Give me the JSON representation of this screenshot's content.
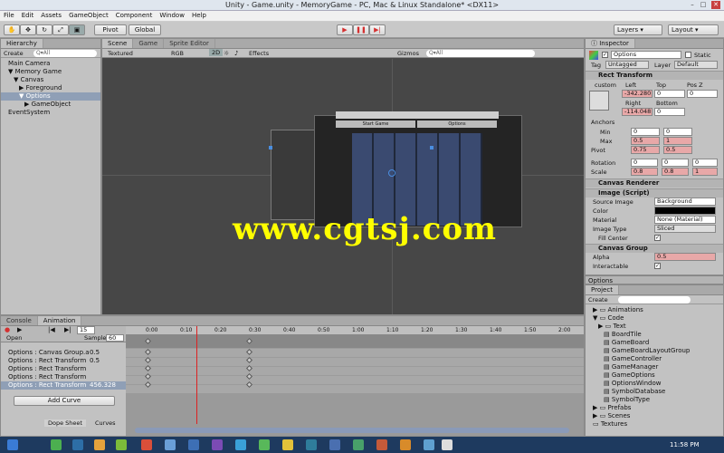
{
  "window": {
    "title": "Unity - Game.unity - MemoryGame - PC, Mac & Linux Standalone* <DX11>"
  },
  "menu": [
    "File",
    "Edit",
    "Assets",
    "GameObject",
    "Component",
    "Window",
    "Help"
  ],
  "toolbar": {
    "pivot": "Pivot",
    "global": "Global",
    "layers": "Layers",
    "layout": "Layout"
  },
  "hierarchy": {
    "tab": "Hierarchy",
    "create": "Create",
    "search_placeholder": "Q▾All",
    "items": [
      "Main Camera",
      "Memory Game",
      "Canvas",
      "Foreground",
      "Options",
      "GameObject",
      "EventSystem"
    ]
  },
  "scene": {
    "tabs": [
      "Scene",
      "Game",
      "Sprite Editor"
    ],
    "textured": "Textured",
    "rgb": "RGB",
    "mode2d": "2D",
    "effects": "Effects",
    "gizmos": "Gizmos",
    "search_placeholder": "Q▾All",
    "ui_buttons": [
      "Start Game",
      "Options"
    ],
    "watermark": "www.cgtsj.com"
  },
  "inspector": {
    "tab": "Inspector",
    "object_name": "Options",
    "static": "Static",
    "tag_label": "Tag",
    "tag": "Untagged",
    "layer_label": "Layer",
    "layer": "Default",
    "rect_transform": "Rect Transform",
    "anchor_preset": "custom",
    "stretch": "stretch",
    "left_label": "Left",
    "top_label": "Top",
    "posz_label": "Pos Z",
    "left": "-342.280",
    "top": "0",
    "posz": "0",
    "right_label": "Right",
    "bottom_label": "Bottom",
    "right": "-114.048",
    "bottom": "0",
    "anchors": "Anchors",
    "min": "Min",
    "max": "Max",
    "pivot": "Pivot",
    "min_x": "0",
    "min_y": "0",
    "max_x": "0.5",
    "max_y": "1",
    "pivot_x": "0.75",
    "pivot_y": "0.5",
    "rotation": "Rotation",
    "scale": "Scale",
    "rot_x": "0",
    "rot_y": "0",
    "rot_z": "0",
    "scale_x": "0.8",
    "scale_y": "0.8",
    "scale_z": "1",
    "canvas_renderer": "Canvas Renderer",
    "image": "Image (Script)",
    "source_image": "Source Image",
    "source_image_val": "Background",
    "color": "Color",
    "material": "Material",
    "material_val": "None (Material)",
    "image_type": "Image Type",
    "image_type_val": "Sliced",
    "fill_center": "Fill Center",
    "canvas_group": "Canvas Group",
    "alpha": "Alpha",
    "alpha_val": "0.5",
    "interactable": "Interactable",
    "blocks_raycasts": "Blocks Raycasts",
    "animator": "Animator",
    "footer": "Options"
  },
  "project": {
    "tab": "Project",
    "create": "Create",
    "items": [
      "Animations",
      "Code",
      "Text",
      "BoardTile",
      "GameBoard",
      "GameBoardLayoutGroup",
      "GameController",
      "GameManager",
      "GameOptions",
      "OptionsWindow",
      "SymbolDatabase",
      "SymbolType",
      "Prefabs",
      "Scenes",
      "Textures"
    ]
  },
  "animation": {
    "tabs": [
      "Console",
      "Animation"
    ],
    "frame": "15",
    "clip": "Open",
    "sample_label": "Sample",
    "sample": "60",
    "timeline": [
      "0:00",
      "0:10",
      "0:20",
      "0:30",
      "0:40",
      "0:50",
      "1:00",
      "1:10",
      "1:20",
      "1:30",
      "1:40",
      "1:50",
      "2:00"
    ],
    "properties": [
      {
        "name": "Options : Canvas Group.а",
        "value": "0.5"
      },
      {
        "name": "Options : Rect Transform",
        "value": "0.5"
      },
      {
        "name": "Options : Rect Transform",
        "value": ""
      },
      {
        "name": "Options : Rect Transform",
        "value": ""
      },
      {
        "name": "Options : Rect Transform",
        "value": "456.328"
      }
    ],
    "add_curve": "Add Curve",
    "dope_sheet": "Dope Sheet",
    "curves": "Curves"
  },
  "taskbar": {
    "time": "11:58 PM"
  },
  "colors": {
    "selection": "#8f9fb6",
    "scene_bg": "#474747",
    "playhead": "#d22",
    "watermark": "#ffff00",
    "play_red": "#d43030"
  }
}
